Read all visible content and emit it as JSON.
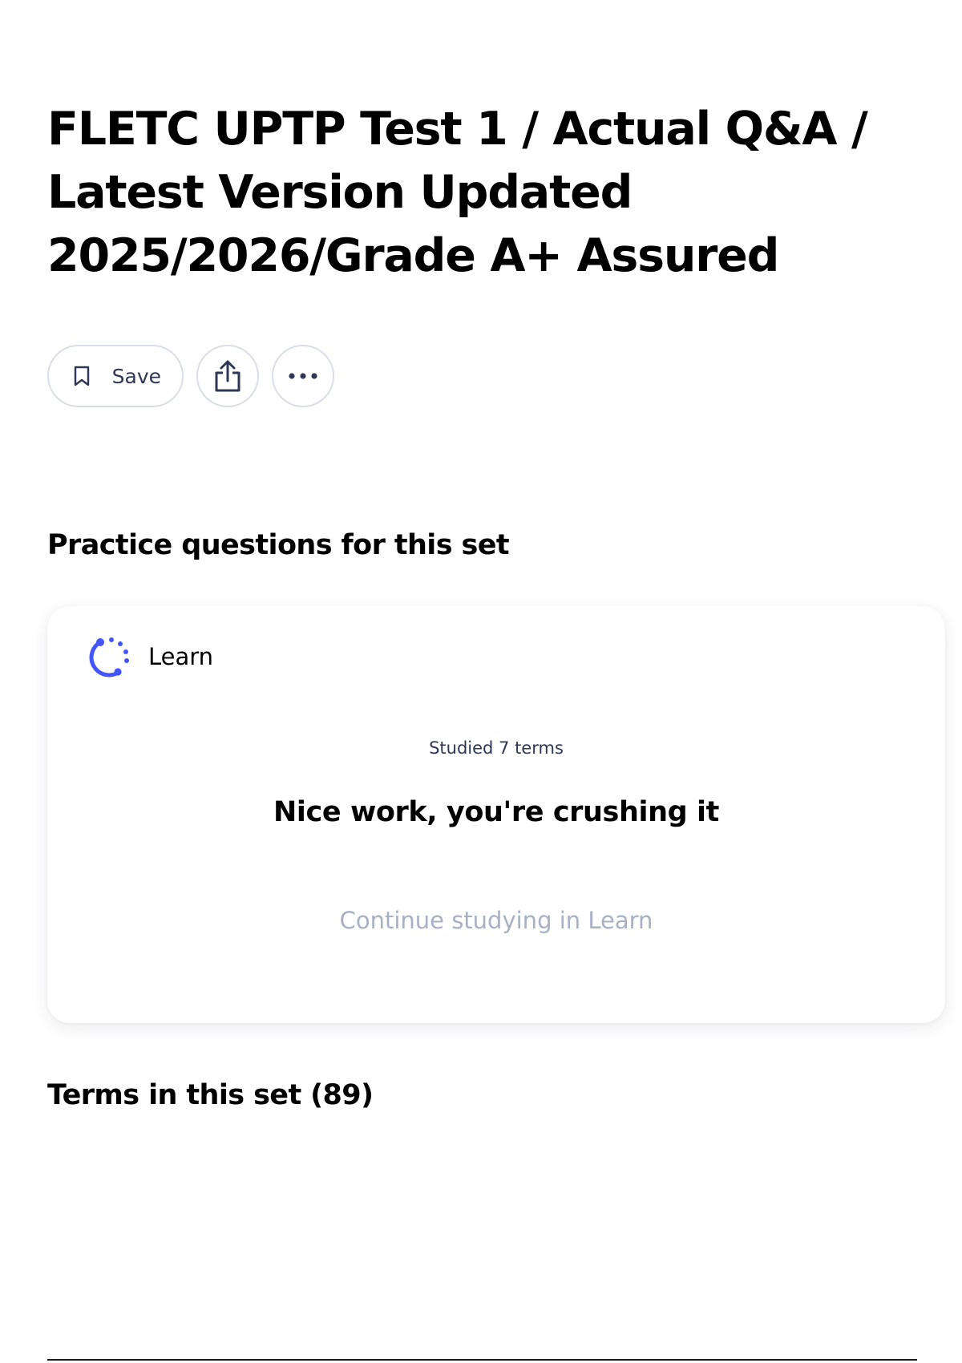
{
  "set": {
    "title": "FLETC UPTP Test 1 / Actual Q&A / Latest Version Updated 2025/2026/Grade A+ Assured"
  },
  "actions": {
    "save_label": "Save",
    "save_icon": "bookmark-icon",
    "share_icon": "share-icon",
    "more_icon": "more-horizontal-icon"
  },
  "practice": {
    "heading": "Practice questions for this set",
    "learn": {
      "icon": "learn-progress-icon",
      "label": "Learn",
      "studied_caption": "Studied 7 terms",
      "message": "Nice work, you're crushing it",
      "continue_label": "Continue studying in Learn"
    }
  },
  "terms": {
    "heading": "Terms in this set (89)"
  },
  "colors": {
    "text_primary": "#000000",
    "text_secondary": "#2e3856",
    "muted": "#a8b1c4",
    "accent": "#4255ff",
    "border": "#d9dde8"
  }
}
